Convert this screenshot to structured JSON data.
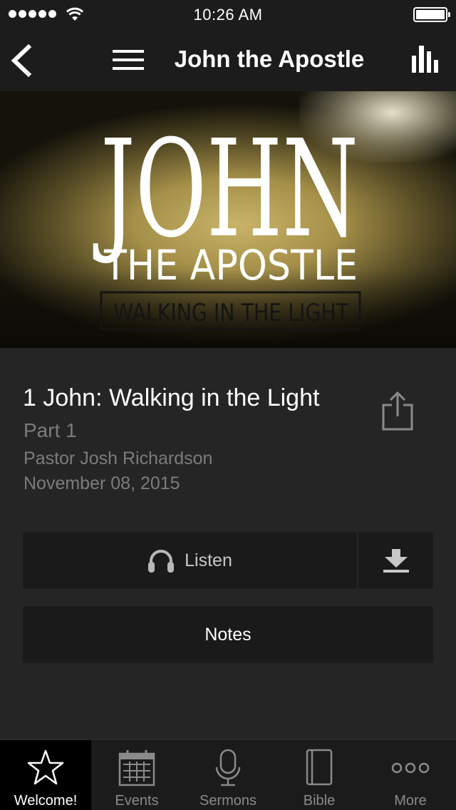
{
  "status_bar": {
    "time": "10:26 AM",
    "signal_dots": 5,
    "battery_level_percent": 100
  },
  "nav": {
    "title": "John the Apostle",
    "back_icon": "chevron-left-icon",
    "menu_icon": "hamburger-menu-icon",
    "stats_icon": "bar-chart-icon"
  },
  "hero": {
    "line1": "JOHN",
    "line2": "THE APOSTLE",
    "line3": "WALKING IN THE LIGHT"
  },
  "sermon": {
    "title": "1 John: Walking in the Light",
    "part": "Part 1",
    "speaker": "Pastor Josh Richardson",
    "date": "November 08, 2015",
    "share_icon": "share-icon"
  },
  "actions": {
    "listen_label": "Listen",
    "listen_icon": "headphones-icon",
    "download_icon": "download-icon",
    "notes_label": "Notes"
  },
  "tabs": [
    {
      "label": "Welcome!",
      "icon": "star-icon",
      "active": true
    },
    {
      "label": "Events",
      "icon": "calendar-icon",
      "active": false
    },
    {
      "label": "Sermons",
      "icon": "microphone-icon",
      "active": false
    },
    {
      "label": "Bible",
      "icon": "book-icon",
      "active": false
    },
    {
      "label": "More",
      "icon": "more-icon",
      "active": false
    }
  ],
  "colors": {
    "background": "#252525",
    "bar": "#1c1c1c",
    "button": "#1a1a1a",
    "secondary_text": "#7c7c7c",
    "tab_inactive": "#8a8a8a"
  }
}
